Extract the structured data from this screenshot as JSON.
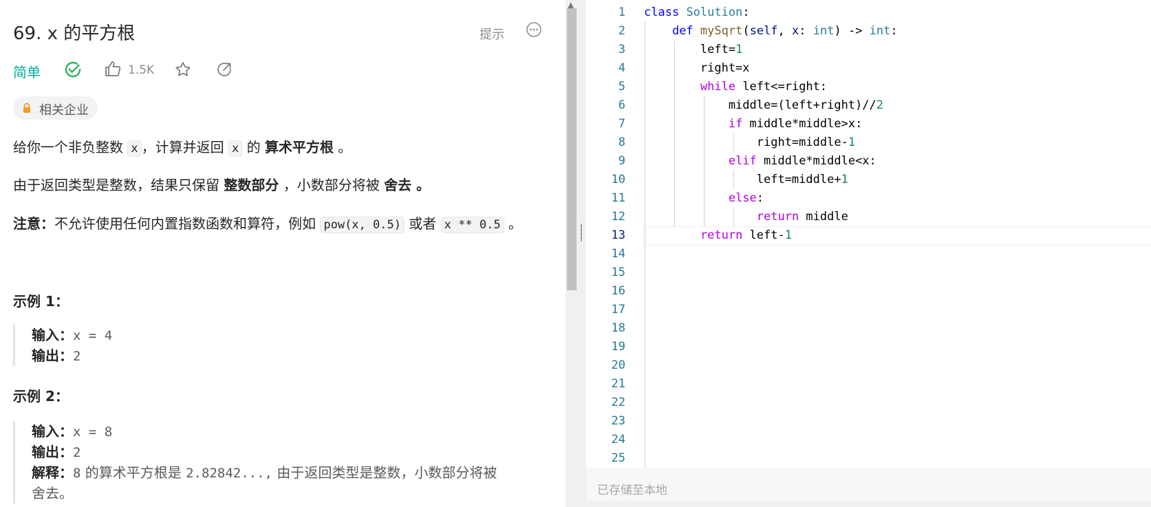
{
  "problem": {
    "title": "69. x 的平方根",
    "hint_label": "提示",
    "difficulty": "简单",
    "likes": "1.5K",
    "company_tag": "相关企业",
    "colors": {
      "difficulty": "#00af9b",
      "solved": "#2db55d"
    }
  },
  "description": {
    "p1": {
      "t1": "给你一个非负整数 ",
      "c1": "x",
      "t2": "，计算并返回 ",
      "c2": "x",
      "t3": " 的 ",
      "b1": "算术平方根",
      "t4": " 。"
    },
    "p2": {
      "t1": "由于返回类型是整数，结果只保留 ",
      "b1": "整数部分",
      "t2": " ，小数部分将被 ",
      "b2": "舍去 。"
    },
    "p3": {
      "b1": "注意：",
      "t1": "不允许使用任何内置指数函数和算符，例如 ",
      "c1": "pow(x, 0.5)",
      "t2": " 或者 ",
      "c2": "x ** 0.5",
      "t3": " 。"
    }
  },
  "examples": [
    {
      "heading": "示例 1：",
      "input_label": "输入：",
      "input": "x = 4",
      "output_label": "输出：",
      "output": "2"
    },
    {
      "heading": "示例 2：",
      "input_label": "输入：",
      "input": "x = 8",
      "output_label": "输出：",
      "output": "2",
      "explain_label": "解释：",
      "explain_val": "8",
      "explain_t1": " 的算术平方根是 ",
      "explain_val2": "2.82842...,",
      "explain_t2": " 由于返回类型是整数，小数部分将被",
      "explain_t3": "舍去。"
    }
  ],
  "editor": {
    "line_numbers": [
      "1",
      "2",
      "3",
      "4",
      "5",
      "6",
      "7",
      "8",
      "9",
      "10",
      "11",
      "12",
      "13",
      "14",
      "15",
      "16",
      "17",
      "18",
      "19",
      "20",
      "21",
      "22",
      "23",
      "24",
      "25"
    ],
    "current_line": 13,
    "save_status": "已存储至本地"
  }
}
